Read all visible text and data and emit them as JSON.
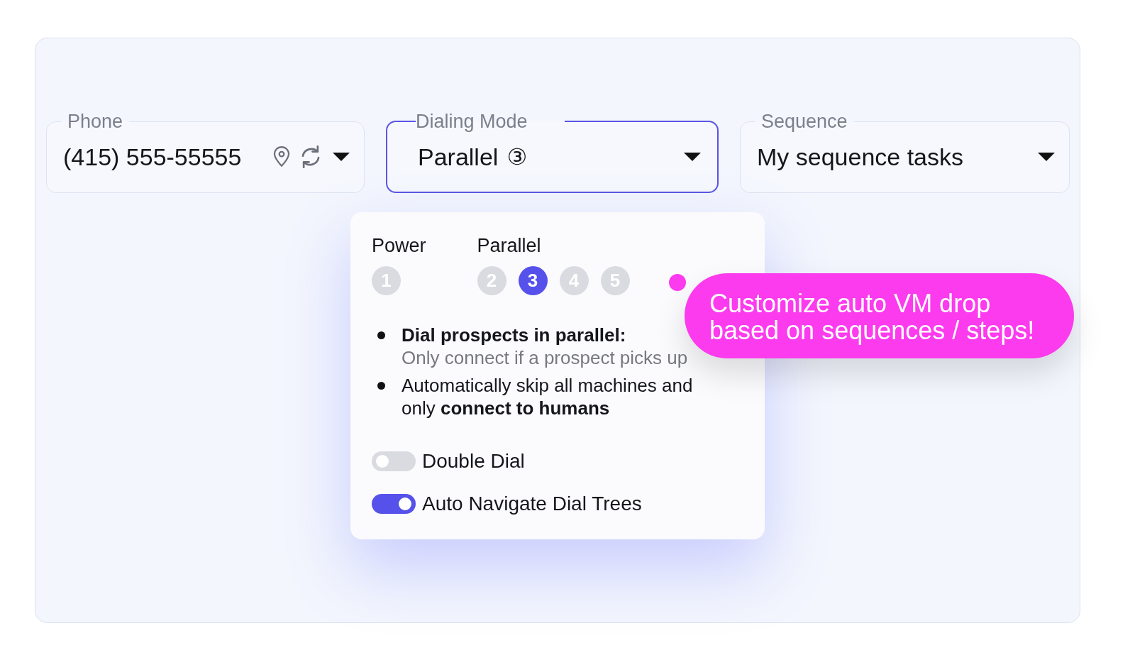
{
  "fields": [
    {
      "kind": "phone",
      "label": "Phone",
      "value": "(415) 555-55555",
      "focused": false
    },
    {
      "kind": "mode",
      "label": "Dialing Mode",
      "value": "Parallel",
      "badge": "③",
      "focused": true
    },
    {
      "kind": "sequence",
      "label": "Sequence",
      "value": "My sequence tasks",
      "focused": false
    }
  ],
  "dialing_menu": {
    "groups": [
      {
        "label": "Power",
        "options": [
          {
            "label": "1",
            "selected": false
          }
        ]
      },
      {
        "label": "Parallel",
        "options": [
          {
            "label": "2",
            "selected": false
          },
          {
            "label": "3",
            "selected": true
          },
          {
            "label": "4",
            "selected": false
          },
          {
            "label": "5",
            "selected": false
          }
        ]
      }
    ],
    "bullets": [
      {
        "kind": "titled",
        "title": "Dial prospects in parallel:",
        "note": "Only connect if a prospect picks up"
      },
      {
        "kind": "plain",
        "text": "Automatically skip all machines and only **connect to humans**"
      }
    ],
    "toggles": [
      {
        "label": "Double Dial",
        "on": false
      },
      {
        "label": "Auto Navigate Dial Trees",
        "on": true
      }
    ]
  },
  "callout": {
    "text": "Customize auto VM drop based on sequences / steps!"
  }
}
